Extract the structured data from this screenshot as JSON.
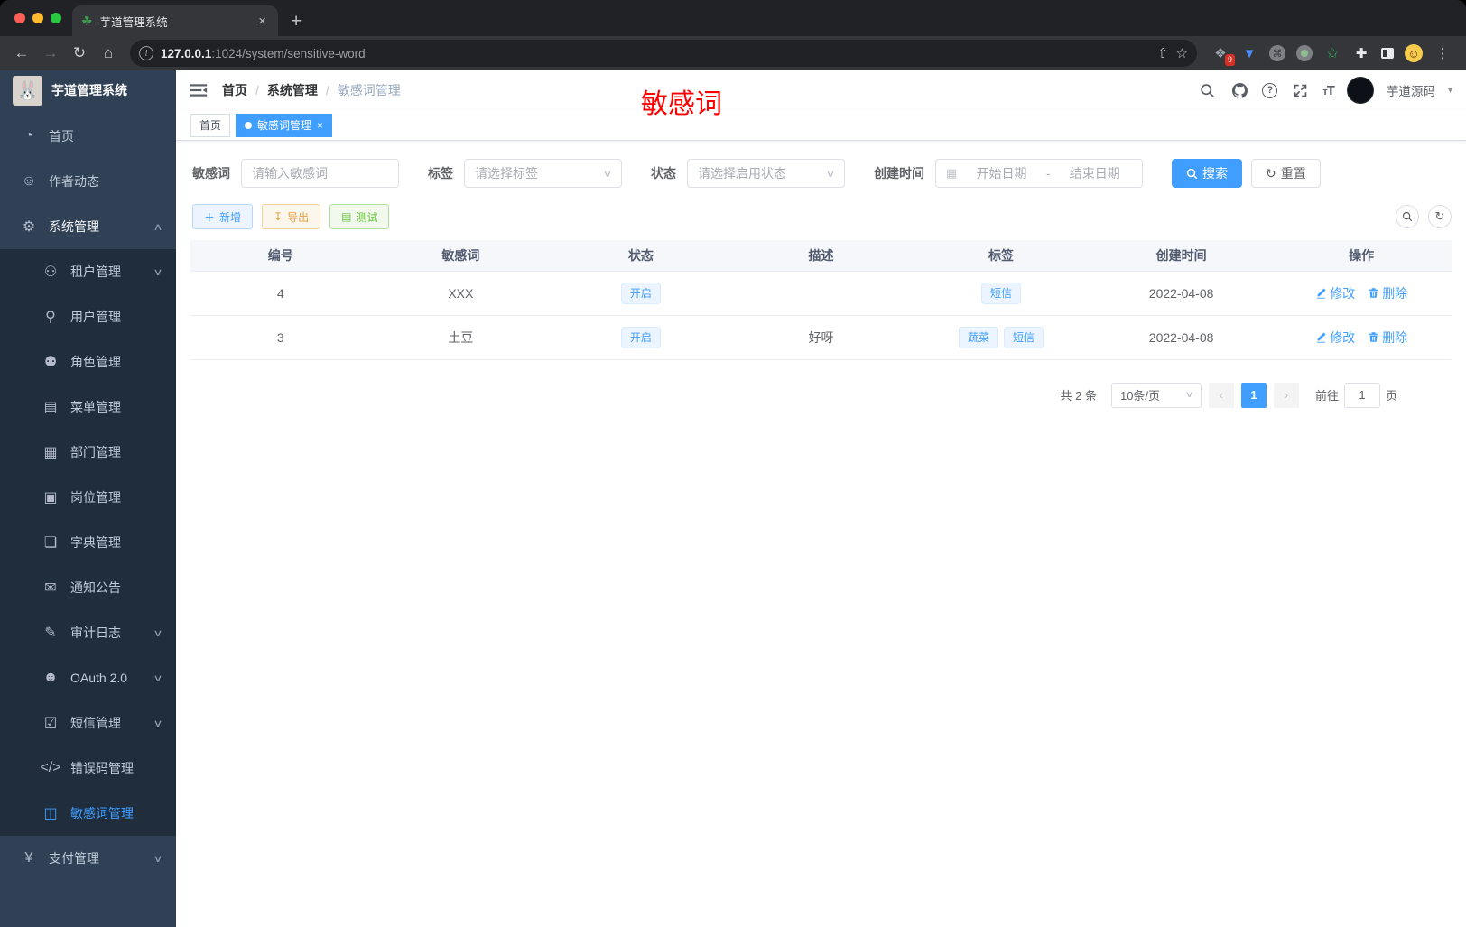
{
  "browser": {
    "tab_title": "芋道管理系统",
    "close_tab": "×",
    "new_tab": "+",
    "url_host": "127.0.0.1",
    "url_rest": ":1024/system/sensitive-word",
    "extension_badge": "9"
  },
  "sidebar": {
    "title": "芋道管理系统",
    "items": [
      {
        "label": "首页",
        "icon": "dashboard-icon",
        "level": 1
      },
      {
        "label": "作者动态",
        "icon": "author-news-icon",
        "level": 1
      },
      {
        "label": "系统管理",
        "icon": "gear-icon",
        "level": 1,
        "chevron": "up",
        "open": true
      },
      {
        "label": "租户管理",
        "icon": "tenant-icon",
        "level": 2,
        "chevron": "down"
      },
      {
        "label": "用户管理",
        "icon": "user-icon",
        "level": 2
      },
      {
        "label": "角色管理",
        "icon": "role-icon",
        "level": 2
      },
      {
        "label": "菜单管理",
        "icon": "menu-tree-icon",
        "level": 2
      },
      {
        "label": "部门管理",
        "icon": "department-icon",
        "level": 2
      },
      {
        "label": "岗位管理",
        "icon": "post-icon",
        "level": 2
      },
      {
        "label": "字典管理",
        "icon": "dictionary-icon",
        "level": 2
      },
      {
        "label": "通知公告",
        "icon": "notice-icon",
        "level": 2
      },
      {
        "label": "审计日志",
        "icon": "audit-log-icon",
        "level": 2,
        "chevron": "down"
      },
      {
        "label": "OAuth 2.0",
        "icon": "oauth-icon",
        "level": 2,
        "chevron": "down"
      },
      {
        "label": "短信管理",
        "icon": "sms-icon",
        "level": 2,
        "chevron": "down"
      },
      {
        "label": "错误码管理",
        "icon": "error-code-icon",
        "level": 2
      },
      {
        "label": "敏感词管理",
        "icon": "sensitive-word-icon",
        "level": 2,
        "active": true
      },
      {
        "label": "支付管理",
        "icon": "payment-icon",
        "level": 1,
        "chevron": "down"
      }
    ]
  },
  "navbar": {
    "breadcrumb": [
      "首页",
      "系统管理",
      "敏感词管理"
    ],
    "annotation": "敏感词",
    "username": "芋道源码"
  },
  "tags": [
    {
      "label": "首页",
      "active": false
    },
    {
      "label": "敏感词管理",
      "active": true,
      "close": "×"
    }
  ],
  "filters": {
    "keyword_label": "敏感词",
    "keyword_placeholder": "请输入敏感词",
    "tag_label": "标签",
    "tag_placeholder": "请选择标签",
    "status_label": "状态",
    "status_placeholder": "请选择启用状态",
    "date_label": "创建时间",
    "date_start": "开始日期",
    "date_separator": "-",
    "date_end": "结束日期",
    "search_label": "搜索",
    "reset_label": "重置"
  },
  "toolbar": {
    "add_label": "新增",
    "export_label": "导出",
    "test_label": "测试"
  },
  "table": {
    "headers": [
      "编号",
      "敏感词",
      "状态",
      "描述",
      "标签",
      "创建时间",
      "操作"
    ],
    "rows": [
      {
        "id": "4",
        "word": "XXX",
        "status": "开启",
        "description": "",
        "tags": [
          "短信"
        ],
        "created": "2022-04-08"
      },
      {
        "id": "3",
        "word": "土豆",
        "status": "开启",
        "description": "好呀",
        "tags": [
          "蔬菜",
          "短信"
        ],
        "created": "2022-04-08"
      }
    ],
    "edit_label": "修改",
    "delete_label": "删除"
  },
  "pagination": {
    "total": "共 2 条",
    "page_size": "10条/页",
    "current_page": "1",
    "prev": "‹",
    "next": "›",
    "goto_label": "前往",
    "goto_value": "1",
    "unit_label": "页"
  },
  "colors": {
    "primary": "#409eff",
    "warning": "#e6a23c",
    "success": "#67c23a",
    "annotation_red": "#ff0000",
    "sidebar_bg": "#304156",
    "submenu_bg": "#1f2d3d"
  }
}
